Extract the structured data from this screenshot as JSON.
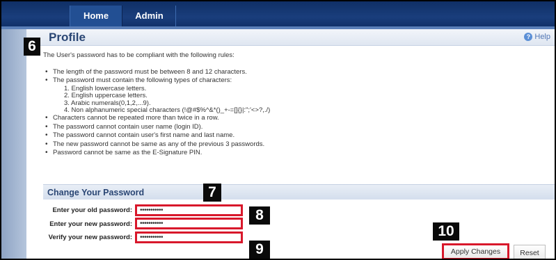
{
  "nav": {
    "tabs": [
      {
        "label": "Home",
        "active": true
      },
      {
        "label": "Admin",
        "active": false
      }
    ]
  },
  "profile": {
    "title": "Profile",
    "help_label": "Help",
    "help_icon": "?"
  },
  "callouts": [
    "6",
    "7",
    "8",
    "9",
    "10"
  ],
  "rules": {
    "intro": "The User's password has to be compliant with the following rules:",
    "items": [
      "The length of the password must be between 8 and 12 characters.",
      "The password must contain the following types of characters:",
      "Characters cannot be repeated more than twice in a row.",
      "The password cannot contain user name (login ID).",
      "The password cannot contain user's first name and last name.",
      "The new password cannot be same as any of the previous 3 passwords.",
      "Password cannot be same as the E-Signature PIN."
    ],
    "char_types": [
      "1.   English lowercase letters.",
      "2.   English uppercase letters.",
      "3.   Arabic numerals(0,1,2,...9).",
      "4.   Non alphanumeric special characters (!@#$%^&*()_+-=[]{}|:\";'<>?,./)"
    ]
  },
  "change_password": {
    "title": "Change Your Password",
    "old_label": "Enter your old password:",
    "new_label": "Enter your new password:",
    "verify_label": "Verify your new password:",
    "old_value": "•••••••••••",
    "new_value": "•••••••••••",
    "verify_value": "•••••••••••",
    "apply_label": "Apply Changes",
    "reset_label": "Reset"
  },
  "colors": {
    "nav_bg": "#1a3e7c",
    "highlight": "#d8182b",
    "heading": "#2a4674"
  }
}
